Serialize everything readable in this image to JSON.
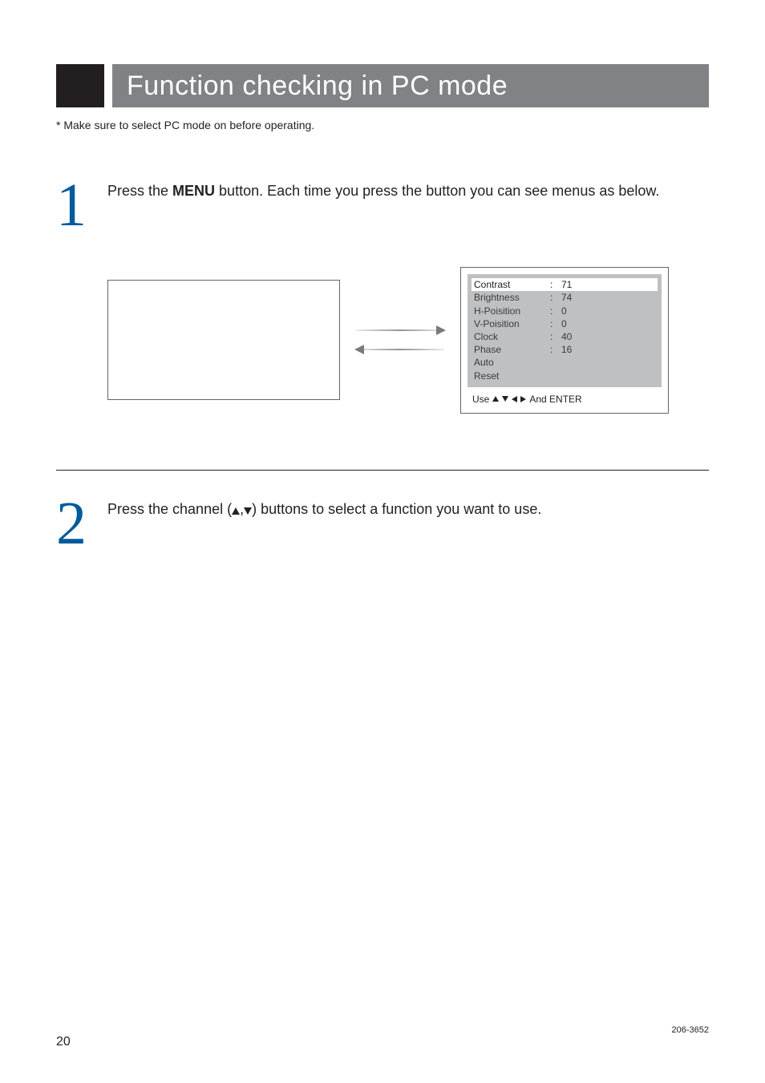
{
  "title": "Function checking in PC mode",
  "note": "* Make sure to select PC mode on before operating.",
  "steps": {
    "s1": {
      "num": "1",
      "pre": "Press the ",
      "bold": "MENU",
      "post": " button. Each time you press the button you can see menus as below."
    },
    "s2": {
      "num": "2",
      "pre": "Press the channel ",
      "post": " buttons to select a function you want to use."
    }
  },
  "menu": {
    "rows": [
      {
        "label": "Contrast",
        "value": "71",
        "highlight": true
      },
      {
        "label": "Brightness",
        "value": "74",
        "highlight": false
      },
      {
        "label": "H-Poisition",
        "value": "0",
        "highlight": false
      },
      {
        "label": "V-Poisition",
        "value": "0",
        "highlight": false
      },
      {
        "label": "Clock",
        "value": "40",
        "highlight": false
      },
      {
        "label": "Phase",
        "value": "16",
        "highlight": false
      },
      {
        "label": "Auto",
        "value": "",
        "highlight": false
      },
      {
        "label": "Reset",
        "value": "",
        "highlight": false
      }
    ],
    "footer_pre": "Use",
    "footer_post": "And ENTER"
  },
  "footer": {
    "page": "20",
    "code": "206-3652"
  }
}
